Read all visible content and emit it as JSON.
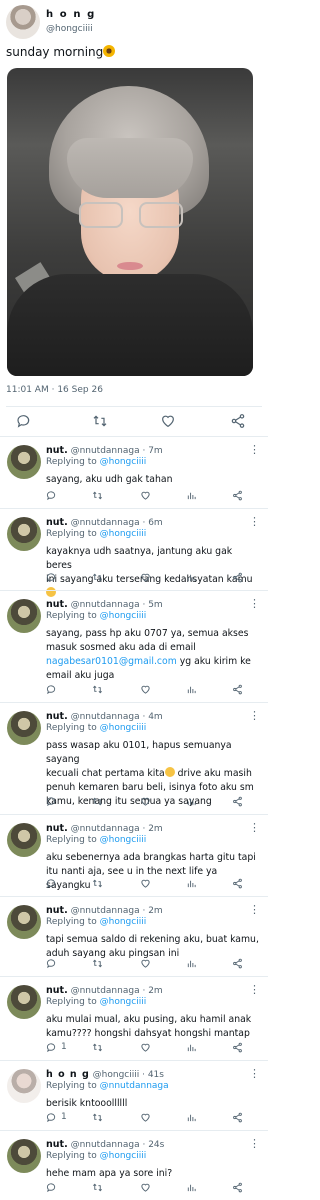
{
  "main_tweet": {
    "display_name": "h o n g",
    "handle": "@hongciiii",
    "text": "sunday morning",
    "text_emoji": "sunflower-icon",
    "time": "11:01 AM",
    "date": "16 Sep 26",
    "meta_separator": " · "
  },
  "replies": [
    {
      "name": "nut.",
      "handle": "@nnutdannaga",
      "time": "7m",
      "replying_label": "Replying to",
      "replying_to": "@hongciiii",
      "lines": [
        "sayang, aku udh gak tahan"
      ],
      "reply_count": "",
      "avatar": "nut"
    },
    {
      "name": "nut.",
      "handle": "@nnutdannaga",
      "time": "6m",
      "replying_label": "Replying to",
      "replying_to": "@hongciiii",
      "lines": [
        "kayaknya udh saatnya, jantung aku gak beres",
        "ini sayang aku terserang kedahsyatan kamu"
      ],
      "reply_count": "",
      "avatar": "nut"
    },
    {
      "name": "nut.",
      "handle": "@nnutdannaga",
      "time": "5m",
      "replying_label": "Replying to",
      "replying_to": "@hongciiii",
      "lines": [
        "sayang, pass hp aku 0707 ya, semua akses",
        "masuk sosmed aku ada di email"
      ],
      "email": "nagabesar0101@gmail.com",
      "email_after": " yg aku kirim ke",
      "last_line": "email aku juga",
      "reply_count": "",
      "avatar": "nut"
    },
    {
      "name": "nut.",
      "handle": "@nnutdannaga",
      "time": "4m",
      "replying_label": "Replying to",
      "replying_to": "@hongciiii",
      "lines": [
        "pass wasap aku 0101, hapus semuanya sayang",
        "kecuali chat pertama kita",
        " drive aku masih",
        "penuh kemaren baru beli, isinya foto aku sm",
        "kamu, kenang itu semua ya sayang"
      ],
      "reply_count": "",
      "avatar": "nut"
    },
    {
      "name": "nut.",
      "handle": "@nnutdannaga",
      "time": "2m",
      "replying_label": "Replying to",
      "replying_to": "@hongciiii",
      "lines": [
        "aku sebenernya ada brangkas harta gitu tapi",
        "itu nanti aja, see u in the next life ya sayangku"
      ],
      "reply_count": "",
      "avatar": "nut"
    },
    {
      "name": "nut.",
      "handle": "@nnutdannaga",
      "time": "2m",
      "replying_label": "Replying to",
      "replying_to": "@hongciiii",
      "lines": [
        "tapi semua saldo di rekening aku, buat kamu,",
        "aduh sayang aku pingsan ini"
      ],
      "reply_count": "",
      "avatar": "nut"
    },
    {
      "name": "nut.",
      "handle": "@nnutdannaga",
      "time": "2m",
      "replying_label": "Replying to",
      "replying_to": "@hongciiii",
      "lines": [
        "aku mulai mual, aku pusing, aku hamil anak",
        "kamu???? hongshi dahsyat hongshi mantap"
      ],
      "reply_count": "1",
      "avatar": "nut"
    },
    {
      "name": "h o n g",
      "handle": "@hongciiii",
      "time": "41s",
      "replying_label": "Replying to",
      "replying_to": "@nnutdannaga",
      "lines": [
        "berisik kntooollllll"
      ],
      "reply_count": "1",
      "avatar": "hong"
    },
    {
      "name": "nut.",
      "handle": "@nnutdannaga",
      "time": "24s",
      "replying_label": "Replying to",
      "replying_to": "@hongciiii",
      "lines": [
        "hehe mam apa ya sore ini?"
      ],
      "reply_count": "",
      "avatar": "nut"
    }
  ],
  "ui": {
    "more_glyph": "⋮",
    "time_separator": " · "
  },
  "colors": {
    "accent": "#1d9bf0",
    "muted": "#536471",
    "divider": "#e6ecf0"
  }
}
